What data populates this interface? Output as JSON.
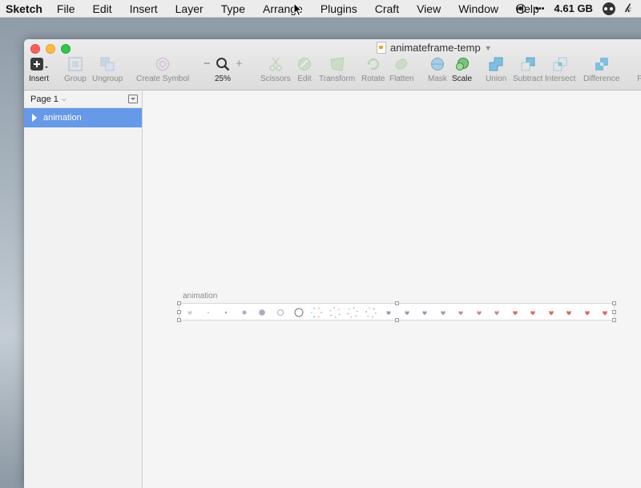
{
  "menubar": {
    "app": "Sketch",
    "items": [
      "File",
      "Edit",
      "Insert",
      "Layer",
      "Type",
      "Arrange",
      "Plugins",
      "Craft",
      "View",
      "Window",
      "Help"
    ],
    "memory": "4.61 GB",
    "more": "•••"
  },
  "window": {
    "title": "animateframe-temp"
  },
  "toolbar": {
    "insert": "Insert",
    "group": "Group",
    "ungroup": "Ungroup",
    "create_symbol": "Create Symbol",
    "zoom_minus": "−",
    "zoom_plus": "+",
    "zoom_level": "25%",
    "scissors": "Scissors",
    "edit": "Edit",
    "transform": "Transform",
    "rotate": "Rotate",
    "flatten": "Flatten",
    "mask": "Mask",
    "scale": "Scale",
    "union": "Union",
    "subtract": "Subtract",
    "intersect": "Intersect",
    "difference": "Difference",
    "forward_partial": "Fo"
  },
  "sidebar": {
    "page": "Page 1",
    "layers": [
      {
        "label": "animation"
      }
    ]
  },
  "canvas": {
    "artboard_label": "animation"
  },
  "colors": {
    "selection": "#6699e8",
    "heart_red": "#e06a5a",
    "heart_purple": "#a591b3",
    "dot_purple": "#b4a6c4"
  }
}
